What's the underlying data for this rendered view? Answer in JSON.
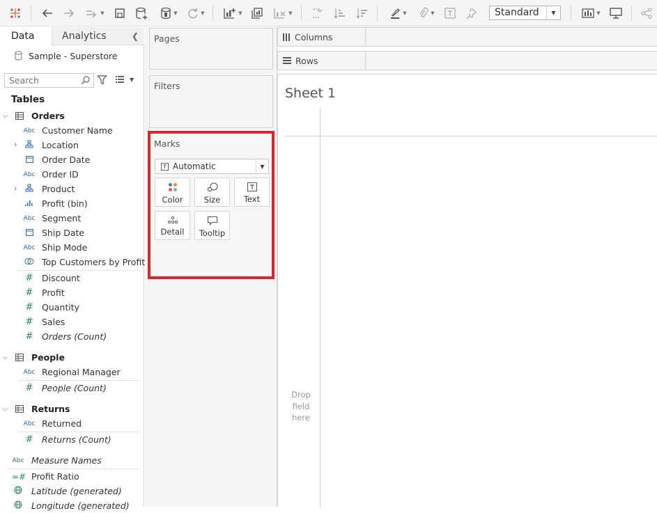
{
  "toolbar": {
    "standard_select": "Standard"
  },
  "datapane": {
    "tab_data": "Data",
    "tab_analytics": "Analytics",
    "datasource": "Sample - Superstore",
    "search_placeholder": "Search",
    "tables_header": "Tables",
    "orders": {
      "label": "Orders",
      "fields": [
        "Customer Name",
        "Location",
        "Order Date",
        "Order ID",
        "Product",
        "Profit (bin)",
        "Segment",
        "Ship Date",
        "Ship Mode",
        "Top Customers by Profit"
      ],
      "measures": [
        "Discount",
        "Profit",
        "Quantity",
        "Sales",
        "Orders (Count)"
      ],
      "abc": "Abc"
    },
    "people": {
      "label": "People",
      "fields": [
        "Regional Manager"
      ],
      "measures": [
        "People (Count)"
      ]
    },
    "returns": {
      "label": "Returns",
      "fields": [
        "Returned"
      ],
      "measures": [
        "Returns (Count)"
      ]
    },
    "loose": [
      "Measure Names",
      "Profit Ratio",
      "Latitude (generated)",
      "Longitude (generated)"
    ]
  },
  "shelves": {
    "pages": "Pages",
    "filters": "Filters",
    "marks": "Marks",
    "mark_type": "Automatic",
    "mark_buttons": [
      "Color",
      "Size",
      "Text",
      "Detail",
      "Tooltip"
    ],
    "columns": "Columns",
    "rows": "Rows"
  },
  "canvas": {
    "sheet_title": "Sheet 1",
    "drop_field": [
      "Drop",
      "field",
      "here"
    ]
  }
}
